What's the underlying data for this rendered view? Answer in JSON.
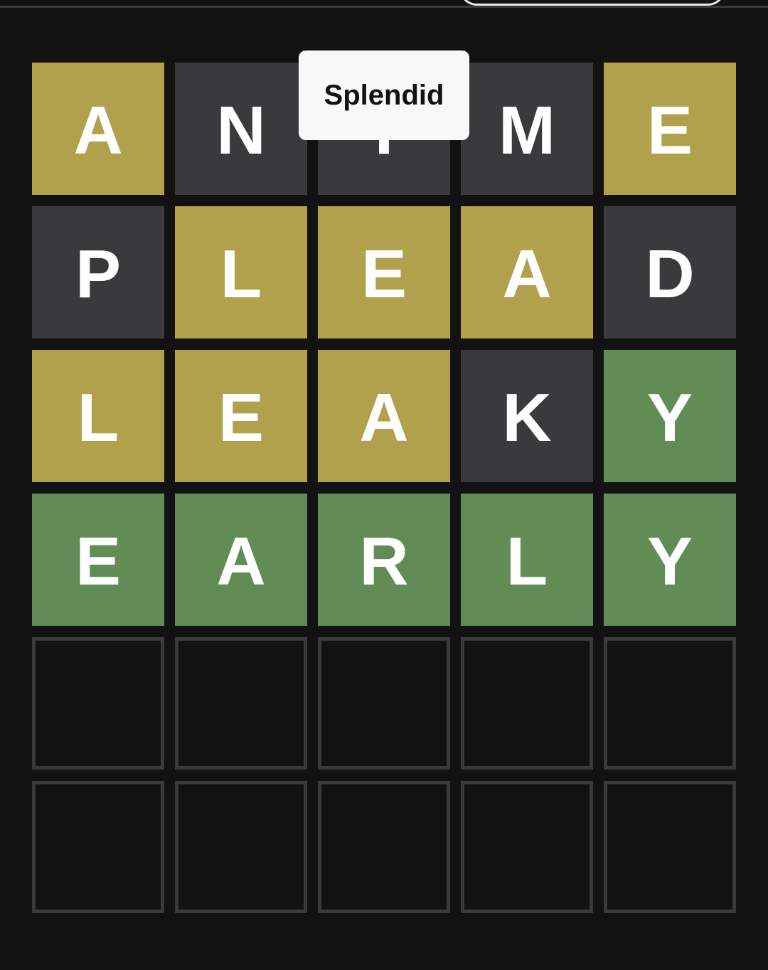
{
  "toast": {
    "message": "Splendid"
  },
  "board": {
    "rows": [
      [
        {
          "letter": "A",
          "state": "present"
        },
        {
          "letter": "N",
          "state": "absent"
        },
        {
          "letter": "T",
          "state": "absent"
        },
        {
          "letter": "M",
          "state": "absent"
        },
        {
          "letter": "E",
          "state": "present"
        }
      ],
      [
        {
          "letter": "P",
          "state": "absent"
        },
        {
          "letter": "L",
          "state": "present"
        },
        {
          "letter": "E",
          "state": "present"
        },
        {
          "letter": "A",
          "state": "present"
        },
        {
          "letter": "D",
          "state": "absent"
        }
      ],
      [
        {
          "letter": "L",
          "state": "present"
        },
        {
          "letter": "E",
          "state": "present"
        },
        {
          "letter": "A",
          "state": "present"
        },
        {
          "letter": "K",
          "state": "absent"
        },
        {
          "letter": "Y",
          "state": "correct"
        }
      ],
      [
        {
          "letter": "E",
          "state": "correct"
        },
        {
          "letter": "A",
          "state": "correct"
        },
        {
          "letter": "R",
          "state": "correct"
        },
        {
          "letter": "L",
          "state": "correct"
        },
        {
          "letter": "Y",
          "state": "correct"
        }
      ],
      [
        {
          "letter": "",
          "state": "empty"
        },
        {
          "letter": "",
          "state": "empty"
        },
        {
          "letter": "",
          "state": "empty"
        },
        {
          "letter": "",
          "state": "empty"
        },
        {
          "letter": "",
          "state": "empty"
        }
      ],
      [
        {
          "letter": "",
          "state": "empty"
        },
        {
          "letter": "",
          "state": "empty"
        },
        {
          "letter": "",
          "state": "empty"
        },
        {
          "letter": "",
          "state": "empty"
        },
        {
          "letter": "",
          "state": "empty"
        }
      ]
    ]
  },
  "colors": {
    "background": "#121213",
    "correct": "#618c55",
    "present": "#b1a04c",
    "absent": "#3a3a3c",
    "empty_border": "#3a3a3c",
    "toast_background": "#f8f8f8",
    "text": "#ffffff"
  }
}
